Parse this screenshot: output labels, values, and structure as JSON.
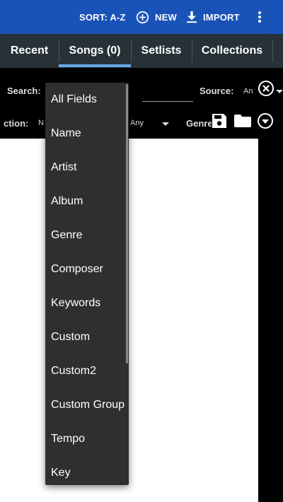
{
  "appbar": {
    "sort_label": "SORT: A-Z",
    "new_label": "NEW",
    "import_label": "IMPORT",
    "bg_color": "#1a53b8"
  },
  "tabs": [
    {
      "label": "Recent"
    },
    {
      "label": "Songs (0)",
      "selected": true
    },
    {
      "label": "Setlists"
    },
    {
      "label": "Collections"
    }
  ],
  "filters": {
    "search_label": "Search:",
    "source_label": "Source:",
    "source_value": "An",
    "collection_label": "ction:",
    "collection_value": "N",
    "second_value": "Any",
    "genre_label": "Genre"
  },
  "search_fields_dropdown": {
    "options": [
      "All Fields",
      "Name",
      "Artist",
      "Album",
      "Genre",
      "Composer",
      "Keywords",
      "Custom",
      "Custom2",
      "Custom Group",
      "Tempo",
      "Key"
    ]
  }
}
